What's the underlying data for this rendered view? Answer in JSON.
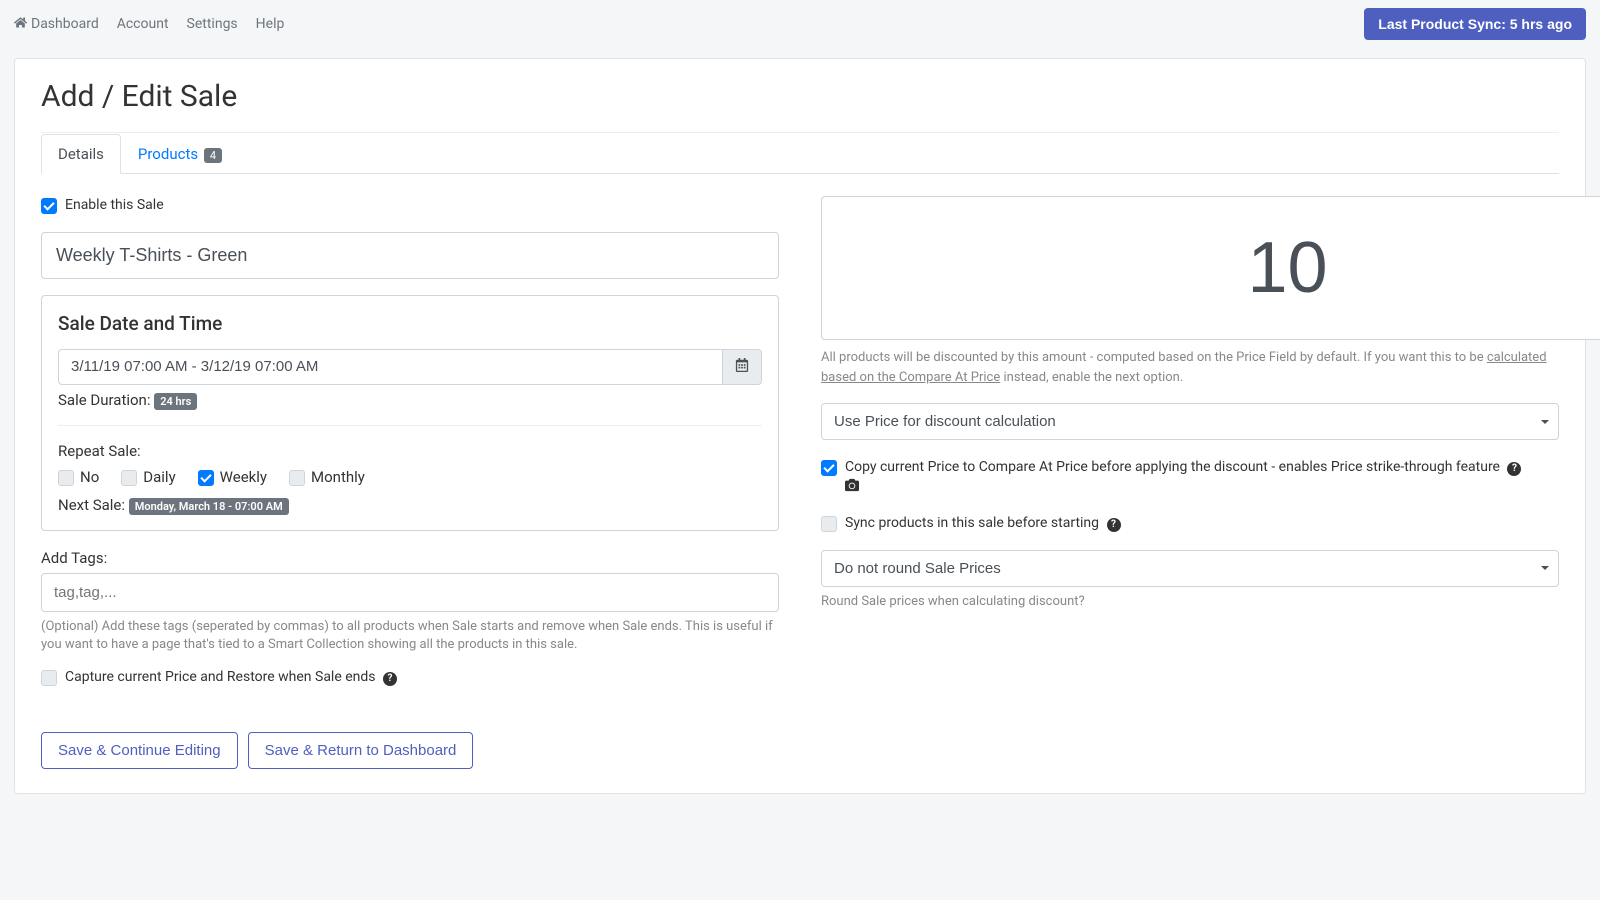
{
  "topnav": {
    "dashboard": "Dashboard",
    "account": "Account",
    "settings": "Settings",
    "help": "Help"
  },
  "sync_button": "Last Product Sync: 5 hrs ago",
  "page_title": "Add / Edit Sale",
  "tabs": {
    "details": "Details",
    "products": "Products",
    "products_count": "4"
  },
  "left": {
    "enable_label": "Enable this Sale",
    "sale_name": "Weekly T-Shirts - Green",
    "date_card_title": "Sale Date and Time",
    "date_range": "3/11/19 07:00 AM - 3/12/19 07:00 AM",
    "duration_label": "Sale Duration: ",
    "duration_value": "24 hrs",
    "repeat_label": "Repeat Sale:",
    "repeat_options": {
      "no": "No",
      "daily": "Daily",
      "weekly": "Weekly",
      "monthly": "Monthly"
    },
    "next_sale_label": "Next Sale: ",
    "next_sale_value": "Monday, March 18 - 07:00 AM",
    "tags_label": "Add Tags:",
    "tags_placeholder": "tag,tag,...",
    "tags_help": "(Optional) Add these tags (seperated by commas) to all products when Sale starts and remove when Sale ends. This is useful if you want to have a page that's tied to a Smart Collection showing all the products in this sale.",
    "capture_label": "Capture current Price and Restore when Sale ends"
  },
  "right": {
    "discount_value": "10",
    "discount_unit": "%",
    "discount_help_pre": "All products will be discounted by this amount - computed based on the Price Field by default. If you want this to be ",
    "discount_help_link": "calculated based on the Compare At Price",
    "discount_help_post": " instead, enable the next option.",
    "price_calc_select": "Use Price for discount calculation",
    "copy_price_label": "Copy current Price to Compare At Price before applying the discount - enables Price strike-through feature",
    "sync_label": "Sync products in this sale before starting",
    "round_select": "Do not round Sale Prices",
    "round_help": "Round Sale prices when calculating discount?"
  },
  "buttons": {
    "save_continue": "Save & Continue Editing",
    "save_return": "Save & Return to Dashboard"
  }
}
